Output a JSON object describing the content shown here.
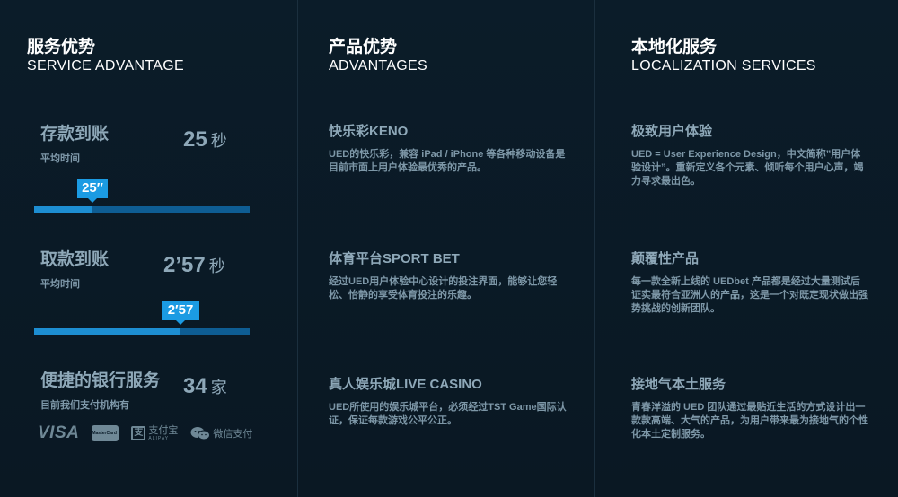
{
  "col1": {
    "title_zh": "服务优势",
    "title_en": "SERVICE ADVANTAGE",
    "stats": [
      {
        "label": "存款到账",
        "sub": "平均时间",
        "value": "25",
        "unit": "秒",
        "bubble": "25″",
        "progress": 0.27
      },
      {
        "label": "取款到账",
        "sub": "平均时间",
        "value": "2’57",
        "unit": "秒",
        "bubble": "2′57",
        "progress": 0.68
      },
      {
        "label": "便捷的银行服务",
        "sub": "目前我们支付机构有",
        "value": "34",
        "unit": "家"
      }
    ],
    "payments": {
      "visa": "VISA",
      "mastercard": "MasterCard",
      "alipay_mark": "支",
      "alipay": "支付宝",
      "alipay_sub": "ALIPAY",
      "wechat": "微信支付"
    }
  },
  "col2": {
    "title_zh": "产品优势",
    "title_en": "ADVANTAGES",
    "blocks": [
      {
        "title": "快乐彩KENO",
        "desc": "UED的快乐彩，兼容 iPad / iPhone 等各种移动设备是目前市面上用户体验最优秀的产品。"
      },
      {
        "title": "体育平台SPORT BET",
        "desc": "经过UED用户体验中心设计的投注界面，能够让您轻松、怡静的享受体育投注的乐趣。"
      },
      {
        "title": "真人娱乐城LIVE CASINO",
        "desc": "UED所使用的娱乐城平台，必须经过TST Game国际认证，保证每款游戏公平公正。"
      }
    ]
  },
  "col3": {
    "title_zh": "本地化服务",
    "title_en": "LOCALIZATION SERVICES",
    "blocks": [
      {
        "title": "极致用户体验",
        "desc": "UED = User Experience Design，中文简称”用户体验设计”。重新定义各个元素、倾听每个用户心声，竭力寻求最出色。"
      },
      {
        "title": "颠覆性产品",
        "desc": "每一款全新上线的 UEDbet 产品都是经过大量测试后证实最符合亚洲人的产品，这是一个对既定现状做出强势挑战的创新团队。"
      },
      {
        "title": "接地气本土服务",
        "desc": "青春洋溢的 UED 团队通过最贴近生活的方式设计出一款款高端、大气的产品，为用户带来最为接地气的个性化本土定制服务。"
      }
    ]
  },
  "colors": {
    "accent": "#1b9be3",
    "track": "#0e5d93",
    "background": "#0b1c29"
  }
}
